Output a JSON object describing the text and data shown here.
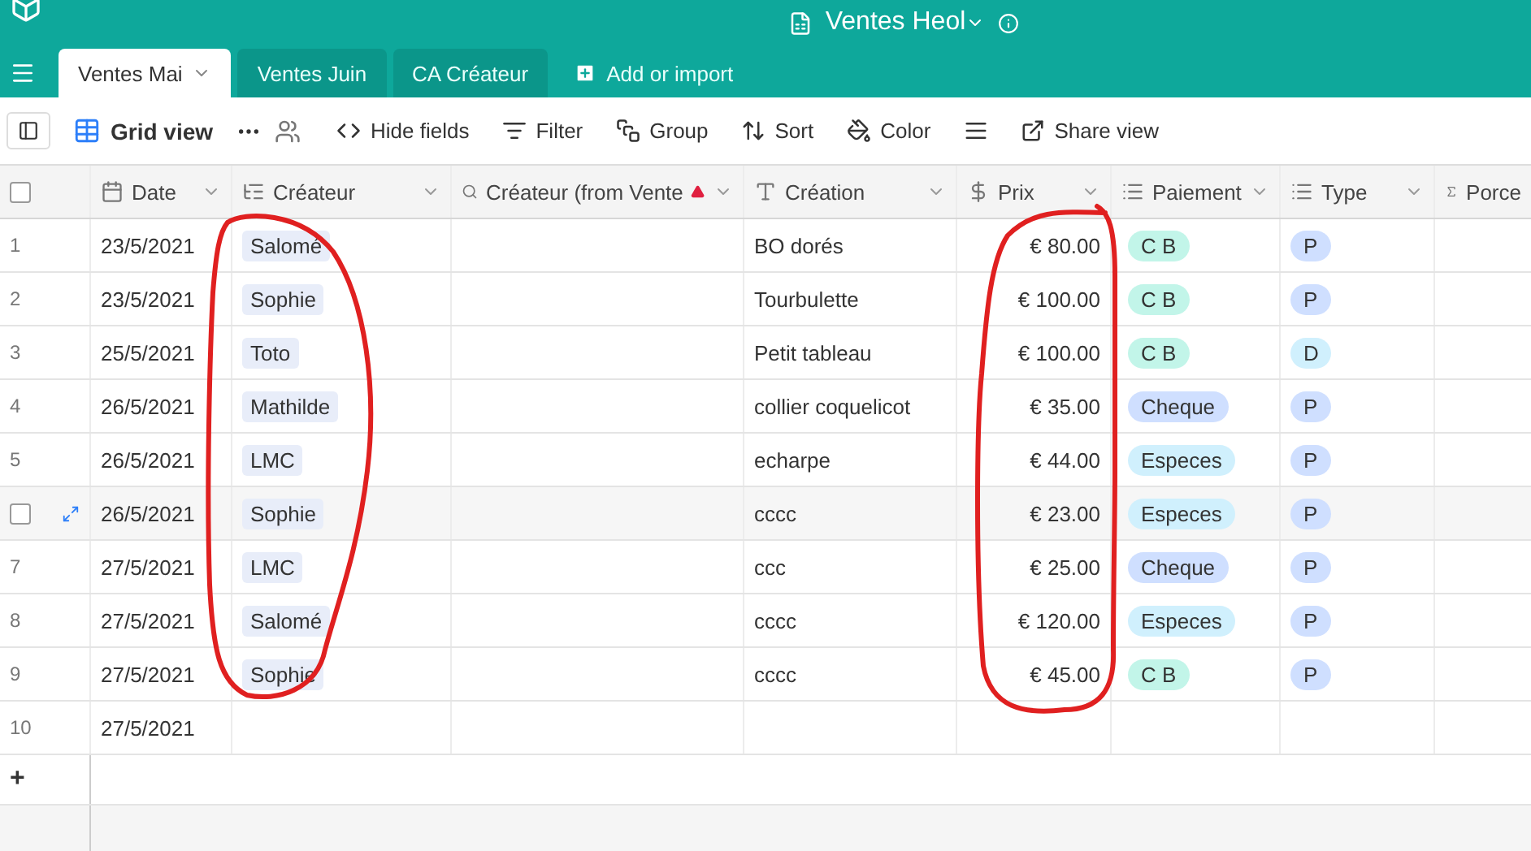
{
  "app": {
    "title": "Ventes Heol"
  },
  "tabs": [
    {
      "label": "Ventes Mai",
      "selected": true
    },
    {
      "label": "Ventes Juin",
      "selected": false
    },
    {
      "label": "CA Créateur",
      "selected": false
    }
  ],
  "add_tab": "Add or import",
  "toolbar": {
    "view": "Grid view",
    "actions": [
      {
        "kind": "hide",
        "label": "Hide fields"
      },
      {
        "kind": "filter",
        "label": "Filter"
      },
      {
        "kind": "group",
        "label": "Group"
      },
      {
        "kind": "sort",
        "label": "Sort"
      },
      {
        "kind": "color",
        "label": "Color"
      },
      {
        "kind": "height"
      },
      {
        "kind": "share",
        "label": "Share view"
      }
    ]
  },
  "table": {
    "all_selected": false,
    "columns": [
      {
        "kind": "date",
        "label": "Date",
        "warning": false
      },
      {
        "kind": "link",
        "label": "Créateur",
        "warning": false
      },
      {
        "kind": "lookup",
        "label": "Créateur (from Vente",
        "warning": true
      },
      {
        "kind": "text",
        "label": "Création",
        "warning": false
      },
      {
        "kind": "currency",
        "label": "Prix",
        "warning": false
      },
      {
        "kind": "select",
        "label": "Paiement",
        "warning": false
      },
      {
        "kind": "select",
        "label": "Type",
        "warning": false
      },
      {
        "kind": "formula",
        "label": "Porce",
        "warning": false
      }
    ],
    "rows": [
      {
        "number": "1",
        "hovered": false,
        "date": "23/5/2021",
        "createur": "Salomé",
        "creation": "BO dorés",
        "prix": "€ 80.00",
        "paiement": {
          "label": "C B",
          "color": "#c2f5e9"
        },
        "type": {
          "label": "P",
          "color": "#cfdfff"
        }
      },
      {
        "number": "2",
        "hovered": false,
        "date": "23/5/2021",
        "createur": "Sophie",
        "creation": "Tourbulette",
        "prix": "€ 100.00",
        "paiement": {
          "label": "C B",
          "color": "#c2f5e9"
        },
        "type": {
          "label": "P",
          "color": "#cfdfff"
        }
      },
      {
        "number": "3",
        "hovered": false,
        "date": "25/5/2021",
        "createur": "Toto",
        "creation": "Petit tableau",
        "prix": "€ 100.00",
        "paiement": {
          "label": "C B",
          "color": "#c2f5e9"
        },
        "type": {
          "label": "D",
          "color": "#d0f0fd"
        }
      },
      {
        "number": "4",
        "hovered": false,
        "date": "26/5/2021",
        "createur": "Mathilde",
        "creation": "collier coquelicot",
        "prix": "€ 35.00",
        "paiement": {
          "label": "Cheque",
          "color": "#cfdfff"
        },
        "type": {
          "label": "P",
          "color": "#cfdfff"
        }
      },
      {
        "number": "5",
        "hovered": false,
        "date": "26/5/2021",
        "createur": "LMC",
        "creation": "echarpe",
        "prix": "€ 44.00",
        "paiement": {
          "label": "Especes",
          "color": "#d0f0fd"
        },
        "type": {
          "label": "P",
          "color": "#cfdfff"
        }
      },
      {
        "hovered": true,
        "checked": false,
        "date": "26/5/2021",
        "createur": "Sophie",
        "creation": "cccc",
        "prix": "€ 23.00",
        "paiement": {
          "label": "Especes",
          "color": "#d0f0fd"
        },
        "type": {
          "label": "P",
          "color": "#cfdfff"
        }
      },
      {
        "number": "7",
        "hovered": false,
        "date": "27/5/2021",
        "createur": "LMC",
        "creation": "ccc",
        "prix": "€ 25.00",
        "paiement": {
          "label": "Cheque",
          "color": "#cfdfff"
        },
        "type": {
          "label": "P",
          "color": "#cfdfff"
        }
      },
      {
        "number": "8",
        "hovered": false,
        "date": "27/5/2021",
        "createur": "Salomé",
        "creation": "cccc",
        "prix": "€ 120.00",
        "paiement": {
          "label": "Especes",
          "color": "#d0f0fd"
        },
        "type": {
          "label": "P",
          "color": "#cfdfff"
        }
      },
      {
        "number": "9",
        "hovered": false,
        "date": "27/5/2021",
        "createur": "Sophie",
        "creation": "cccc",
        "prix": "€ 45.00",
        "paiement": {
          "label": "C B",
          "color": "#c2f5e9"
        },
        "type": {
          "label": "P",
          "color": "#cfdfff"
        }
      },
      {
        "number": "10",
        "hovered": false,
        "date": "27/5/2021"
      }
    ],
    "add_row": "+"
  }
}
